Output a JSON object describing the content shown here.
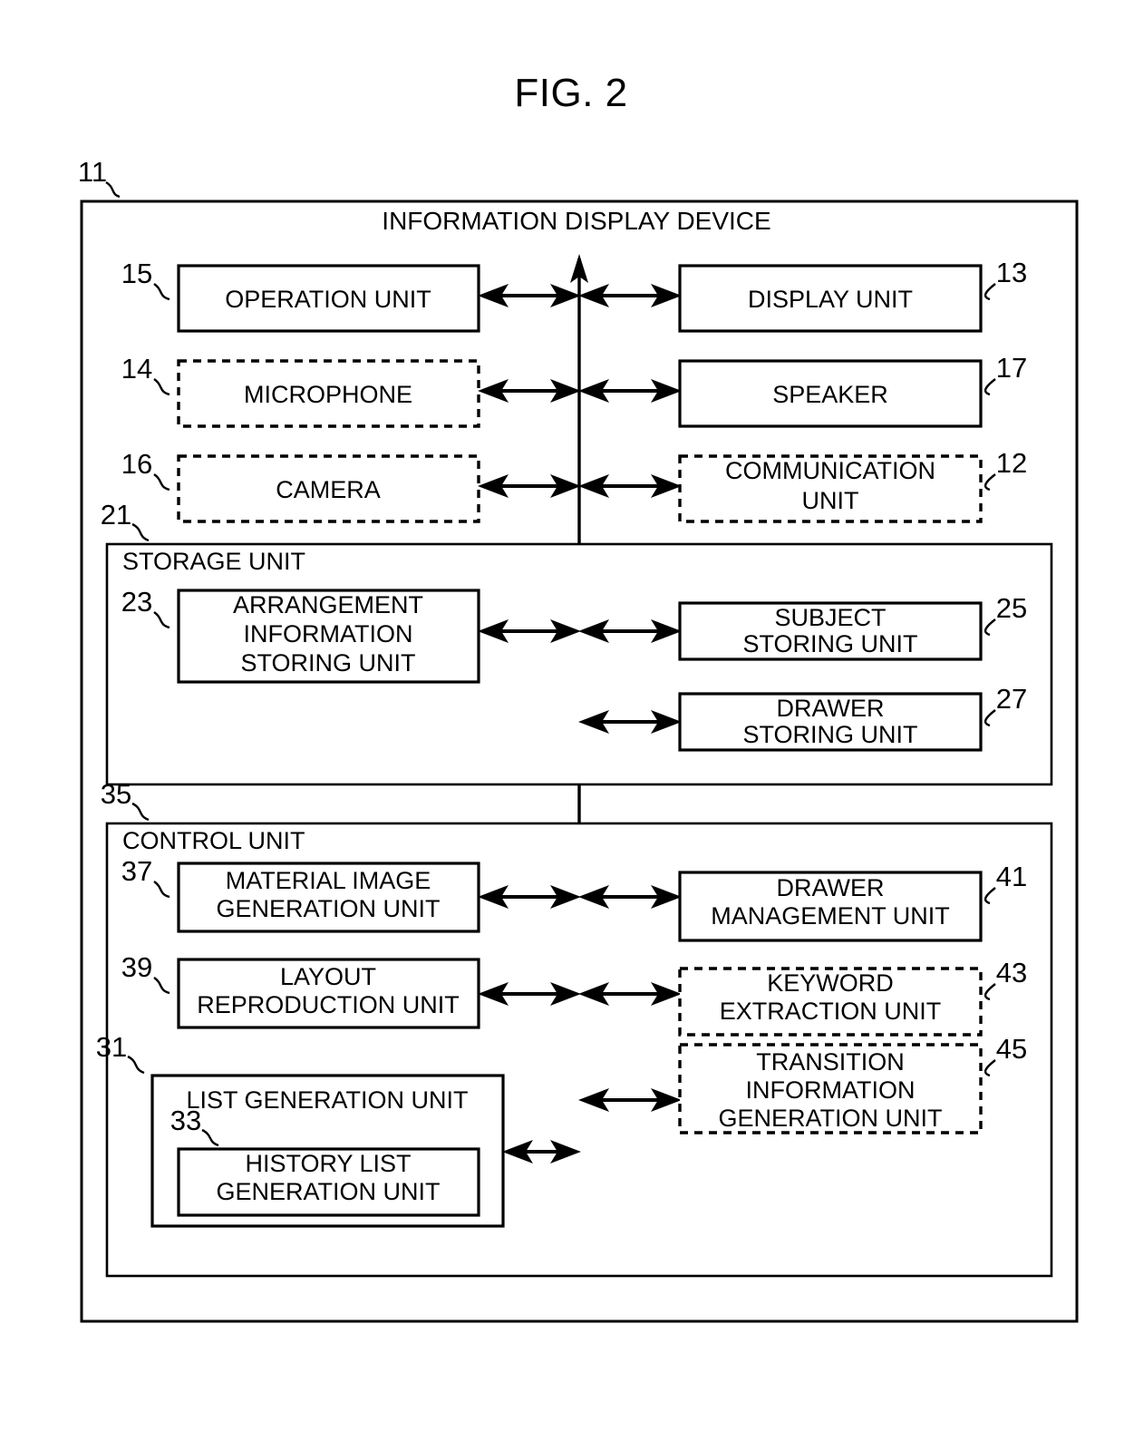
{
  "figure": {
    "title": "FIG. 2",
    "device_title": "INFORMATION DISPLAY DEVICE",
    "device_ref": "11",
    "storage_container_label": "STORAGE UNIT",
    "storage_container_ref": "21",
    "control_container_label": "CONTROL UNIT",
    "control_container_ref": "35"
  },
  "blocks": {
    "operation_unit": {
      "label": "OPERATION UNIT",
      "ref": "15",
      "style": "solid"
    },
    "display_unit": {
      "label": "DISPLAY UNIT",
      "ref": "13",
      "style": "solid"
    },
    "microphone": {
      "label": "MICROPHONE",
      "ref": "14",
      "style": "dashed"
    },
    "speaker": {
      "label": "SPEAKER",
      "ref": "17",
      "style": "solid"
    },
    "camera": {
      "label": "CAMERA",
      "ref": "16",
      "style": "dashed"
    },
    "communication_unit": {
      "label_line1": "COMMUNICATION",
      "label_line2": "UNIT",
      "ref": "12",
      "style": "dashed"
    },
    "arrangement_information_storing_unit": {
      "label_line1": "ARRANGEMENT",
      "label_line2": "INFORMATION",
      "label_line3": "STORING UNIT",
      "ref": "23",
      "style": "solid"
    },
    "subject_storing_unit": {
      "label_line1": "SUBJECT",
      "label_line2": "STORING UNIT",
      "ref": "25",
      "style": "solid"
    },
    "drawer_storing_unit": {
      "label_line1": "DRAWER",
      "label_line2": "STORING UNIT",
      "ref": "27",
      "style": "solid"
    },
    "material_image_generation_unit": {
      "label_line1": "MATERIAL IMAGE",
      "label_line2": "GENERATION UNIT",
      "ref": "37",
      "style": "solid"
    },
    "drawer_management_unit": {
      "label_line1": "DRAWER",
      "label_line2": "MANAGEMENT UNIT",
      "ref": "41",
      "style": "solid"
    },
    "layout_reproduction_unit": {
      "label_line1": "LAYOUT",
      "label_line2": "REPRODUCTION UNIT",
      "ref": "39",
      "style": "solid"
    },
    "keyword_extraction_unit": {
      "label_line1": "KEYWORD",
      "label_line2": "EXTRACTION UNIT",
      "ref": "43",
      "style": "dashed"
    },
    "transition_information_generation_unit": {
      "label_line1": "TRANSITION",
      "label_line2": "INFORMATION",
      "label_line3": "GENERATION UNIT",
      "ref": "45",
      "style": "dashed"
    },
    "list_generation_unit": {
      "label": "LIST GENERATION UNIT",
      "ref": "31",
      "style": "solid"
    },
    "history_list_generation_unit": {
      "label_line1": "HISTORY LIST",
      "label_line2": "GENERATION UNIT",
      "ref": "33",
      "style": "solid"
    }
  },
  "colors": {
    "stroke": "#000000",
    "fill": "#ffffff",
    "background": "#ffffff"
  }
}
